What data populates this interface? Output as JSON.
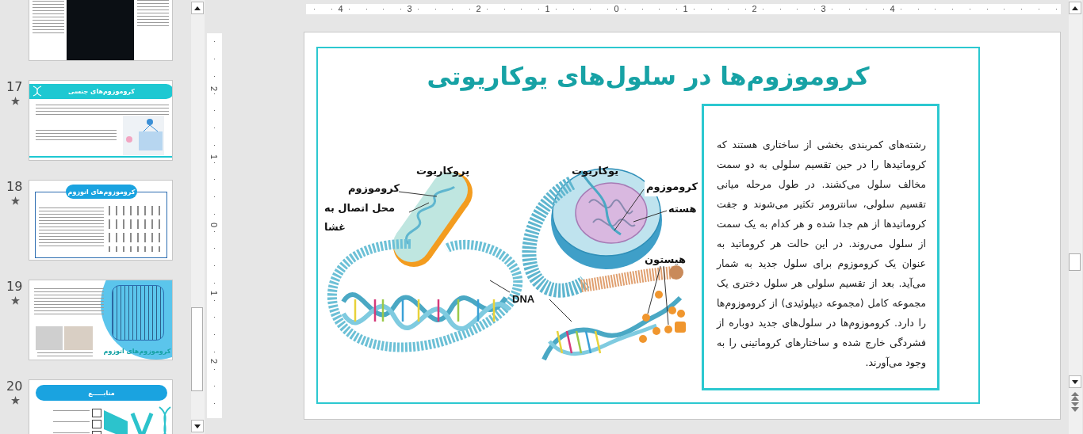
{
  "thumbnail_panel": {
    "slides": [
      {
        "kind": "xy-chromosomes"
      },
      {
        "number": "17",
        "animated": true,
        "kind": "banner",
        "title": "کروموزوم‌های جنسی"
      },
      {
        "number": "18",
        "animated": true,
        "kind": "framed",
        "title": "کروموزوم‌های اتوزوم"
      },
      {
        "number": "19",
        "animated": true,
        "kind": "circle",
        "title": "کروموزوم‌های اتوزوم"
      },
      {
        "number": "20",
        "animated": true,
        "kind": "sources",
        "title": "منابـــــع"
      }
    ]
  },
  "horizontal_ruler": {
    "labels": [
      "4",
      "3",
      "2",
      "1",
      "0",
      "1",
      "2",
      "3",
      "4"
    ]
  },
  "vertical_ruler": {
    "labels": [
      "2",
      "1",
      "0",
      "1",
      "2"
    ]
  },
  "slide": {
    "title": "کروموزوم‌ها در سلول‌های یوکاریوتی",
    "paragraph": "رشته‌های کمربندی بخشی از ساختاری هستند که کروماتیدها را در حین تقسیم سلولی به دو سمت مخالف سلول می‌کشند. در طول مرحله میانی تقسیم سلولی، سانترومر تکثیر می‌شوند و جفت کروماتیدها از هم جدا شده و هر کدام به یک سمت از سلول می‌روند. در این حالت هر کروماتید به عنوان یک کروموزوم برای سلول جدید به شمار می‌آید. بعد از تقسیم سلولی هر سلول دختری یک مجموعه کامل (مجموعه دیپلوئیدی) از کروموزوم‌ها را دارد. کروموزوم‌ها در سلول‌های جدید دوباره از فشردگی خارج شده و ساختارهای کروماتینی را به وجود می‌آورند.",
    "diagram": {
      "labels": [
        {
          "kind": "prokaryote-title",
          "text": "پروکاریوت"
        },
        {
          "kind": "prokaryote-chromosome",
          "text": "کروموزوم"
        },
        {
          "kind": "prokaryote-attachment",
          "text": "محل اتصال به غشا"
        },
        {
          "kind": "eukaryote-title",
          "text": "یوکاریوت"
        },
        {
          "kind": "eukaryote-chromosome",
          "text": "کروموزوم"
        },
        {
          "kind": "eukaryote-nucleus",
          "text": "هسته"
        },
        {
          "kind": "eukaryote-histone",
          "text": "هیستون"
        },
        {
          "kind": "dna",
          "text": "DNA"
        }
      ]
    }
  }
}
